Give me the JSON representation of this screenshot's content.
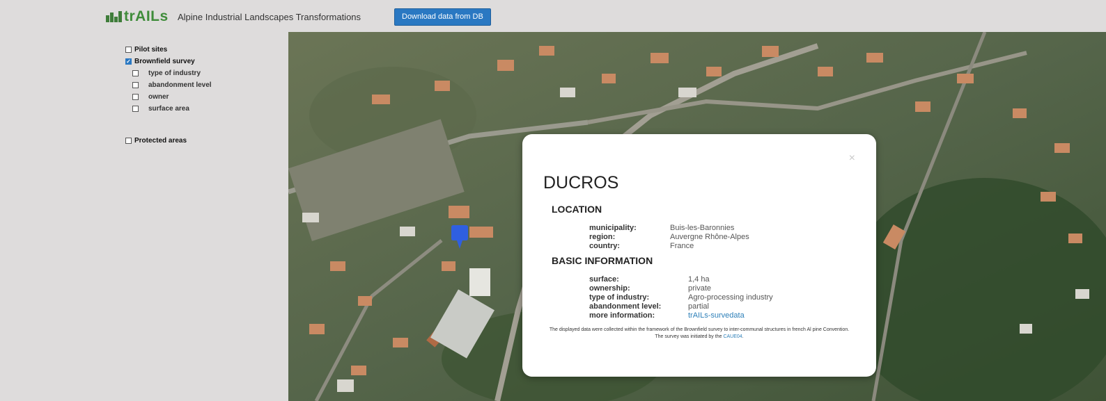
{
  "header": {
    "logo_text": "trAILs",
    "app_title": "Alpine Industrial Landscapes Transformations",
    "download_button": "Download data from DB"
  },
  "sidebar": {
    "layers": [
      {
        "label": "Pilot sites",
        "checked": false
      },
      {
        "label": "Brownfield survey",
        "checked": true
      },
      {
        "label": "Protected areas",
        "checked": false
      }
    ],
    "sublayers": [
      {
        "label": "type of industry",
        "checked": false
      },
      {
        "label": "abandonment level",
        "checked": false
      },
      {
        "label": "owner",
        "checked": false
      },
      {
        "label": "surface area",
        "checked": false
      }
    ]
  },
  "popup": {
    "close_symbol": "×",
    "site_name": "DUCROS",
    "location": {
      "heading": "LOCATION",
      "rows": [
        {
          "key": "municipality:",
          "value": "Buis-les-Baronnies"
        },
        {
          "key": "region:",
          "value": "Auvergne Rhône-Alpes"
        },
        {
          "key": "country:",
          "value": "France"
        }
      ]
    },
    "basic": {
      "heading": "BASIC INFORMATION",
      "rows": [
        {
          "key": "surface:",
          "value": "1,4 ha"
        },
        {
          "key": "ownership:",
          "value": "private"
        },
        {
          "key": "type of industry:",
          "value": "Agro-processing industry"
        },
        {
          "key": "abandonment level:",
          "value": "partial"
        },
        {
          "key": "more information:",
          "value": "trAILs-survedata"
        }
      ]
    },
    "footnote_line1": "The displayed data were collected within the framework of the Brownfield survey to inter-communal structures in french Al pine Convention.",
    "footnote_line2_prefix": "The survey was initiated by the ",
    "footnote_link": "CAUE04",
    "footnote_suffix": "."
  },
  "colors": {
    "accent": "#2a78c2",
    "marker": "#2f5fe0",
    "logo_green": "#3f8c3a",
    "link": "#2c7fb8"
  },
  "icons": {
    "map_marker": "map-marker-icon",
    "checkbox": "checkbox-icon",
    "close": "close-icon"
  }
}
